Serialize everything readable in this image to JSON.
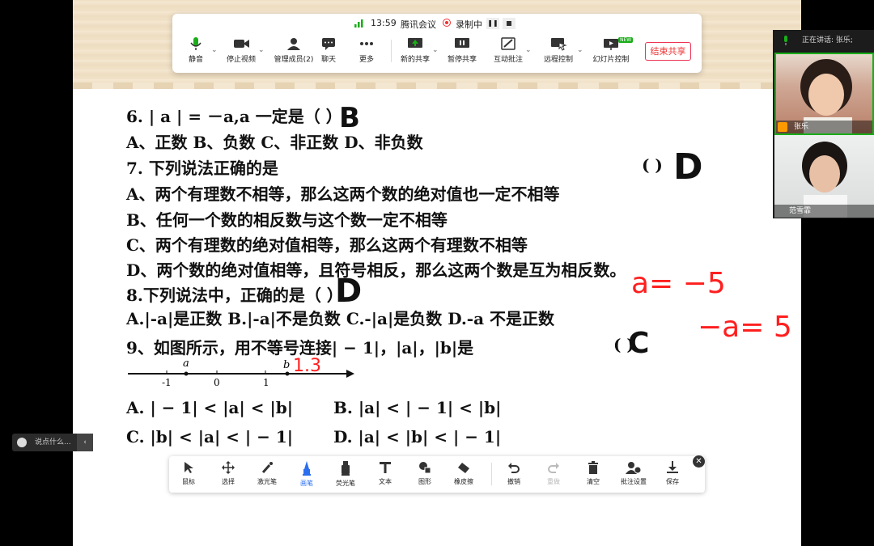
{
  "meeting": {
    "time": "13:59",
    "app_name": "腾讯会议",
    "recording_label": "录制中",
    "toolbar": [
      {
        "label": "静音",
        "icon": "microphone-icon"
      },
      {
        "label": "停止视频",
        "icon": "video-camera-icon"
      },
      {
        "label": "管理成员(2)",
        "icon": "people-icon"
      },
      {
        "label": "聊天",
        "icon": "chat-bubble-icon"
      },
      {
        "label": "更多",
        "icon": "more-dots-icon"
      },
      {
        "label": "新的共享",
        "icon": "share-screen-icon"
      },
      {
        "label": "暂停共享",
        "icon": "pause-share-icon"
      },
      {
        "label": "互动批注",
        "icon": "annotate-icon"
      },
      {
        "label": "远程控制",
        "icon": "remote-control-icon"
      },
      {
        "label": "幻灯片控制",
        "icon": "slideshow-icon",
        "badge": "NEW"
      }
    ],
    "end_share_label": "结束共享",
    "accent_color": "#1aad19",
    "end_color": "#e33b3b"
  },
  "video_panel": {
    "speaking_label": "正在讲话: 张乐;",
    "participants": [
      {
        "name": "张乐"
      },
      {
        "name": "范雪霏"
      }
    ]
  },
  "chat": {
    "placeholder": "说点什么..."
  },
  "document": {
    "lines": [
      "6.  | a | = －a,a 一定是（          ）",
      "A、正数          B、负数          C、非正数          D、非负数",
      "7. 下列说法正确的是",
      "A、两个有理数不相等，那么这两个数的绝对值也一定不相等",
      "B、任何一个数的相反数与这个数一定不相等",
      "C、两个有理数的绝对值相等，那么这两个有理数不相等",
      "D、两个数的绝对值相等，且符号相反，那么这两个数是互为相反数。",
      "8.下列说法中，正确的是（      ）.",
      "A.|-a|是正数  B.|-a|不是负数  C.-|a|是负数  D.-a 不是正数",
      "9、如图所示，用不等号连接| − 1|，|a|，|b|是",
      "A.  | − 1| < |a| < |b|",
      "B.  |a| < | − 1| < |b|",
      "C.  |b| < |a| < | − 1|",
      "D.  |a| < |b| < | − 1|"
    ],
    "q7_paren": "(           )",
    "q9_paren": "(        )",
    "answers": {
      "q6": "B",
      "q7": "D",
      "q8": "D",
      "q9": "C"
    },
    "number_line": {
      "ticks": [
        "-1",
        "0",
        "1"
      ],
      "points": [
        "a",
        "b"
      ],
      "handwritten_label": "1.3"
    },
    "red_notes": [
      "a= −5",
      "−a= 5"
    ]
  },
  "annotation_toolbar": {
    "tools": [
      {
        "label": "鼠标",
        "icon": "cursor-icon"
      },
      {
        "label": "选择",
        "icon": "move-icon"
      },
      {
        "label": "激光笔",
        "icon": "laser-pen-icon"
      },
      {
        "label": "画笔",
        "icon": "brush-icon",
        "active": true
      },
      {
        "label": "荧光笔",
        "icon": "highlighter-icon"
      },
      {
        "label": "文本",
        "icon": "text-icon"
      },
      {
        "label": "图形",
        "icon": "shapes-icon"
      },
      {
        "label": "橡皮擦",
        "icon": "eraser-icon"
      },
      {
        "label": "撤销",
        "icon": "undo-icon"
      },
      {
        "label": "重做",
        "icon": "redo-icon",
        "disabled": true
      },
      {
        "label": "清空",
        "icon": "trash-icon"
      },
      {
        "label": "批注设置",
        "icon": "annotation-settings-icon"
      },
      {
        "label": "保存",
        "icon": "save-download-icon"
      }
    ],
    "active_color": "#2b6ff0"
  }
}
